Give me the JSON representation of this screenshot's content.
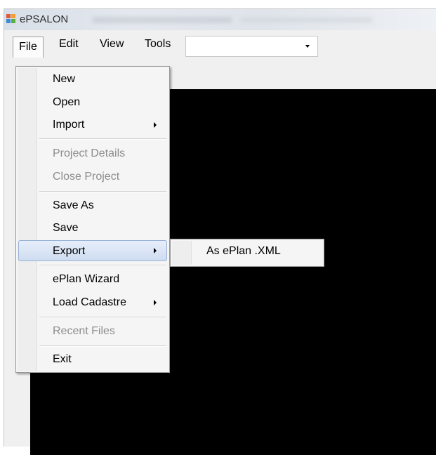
{
  "window": {
    "title": "ePSALON"
  },
  "menubar": {
    "items": [
      "File",
      "Edit",
      "View",
      "Tools"
    ],
    "combo_value": ""
  },
  "file_menu": {
    "new": "New",
    "open": "Open",
    "import": "Import",
    "project_details": "Project Details",
    "close_project": "Close Project",
    "save_as": "Save As",
    "save": "Save",
    "export": "Export",
    "eplan_wizard": "ePlan Wizard",
    "load_cadastre": "Load Cadastre",
    "recent_files": "Recent Files",
    "exit": "Exit"
  },
  "export_submenu": {
    "as_eplan_xml": "As ePlan .XML"
  },
  "colors": {
    "highlight": "#cfdcf0",
    "canvas": "#000000",
    "disabled_text": "#8d8d8d"
  }
}
